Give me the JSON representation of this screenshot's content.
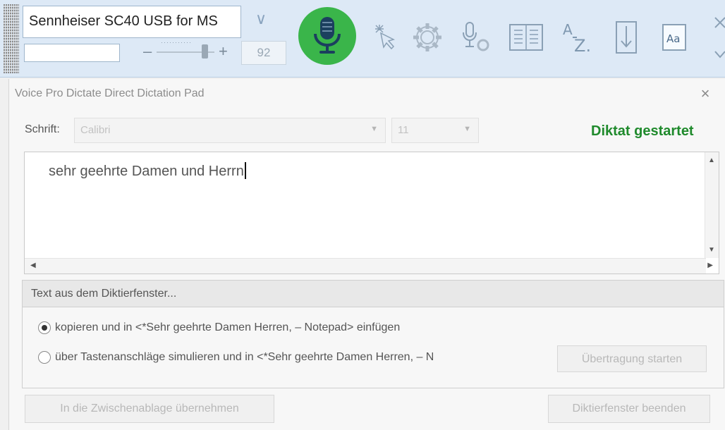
{
  "toolbar": {
    "device_name": "Sennheiser SC40 USB for MS",
    "device_dropdown_glyph": "∨",
    "volume_minus": "–",
    "volume_plus": "+",
    "volume_ticks": "···········",
    "volume_value": "92",
    "volume_level_fraction": 0.92,
    "icons": [
      "microphone-icon",
      "cursor-click-icon",
      "gear-icon",
      "mic-settings-icon",
      "book-icon",
      "a-z-sort-icon",
      "download-icon",
      "font-icon",
      "close-icon",
      "chevron-down-icon"
    ],
    "mic_color": "#3ab54a"
  },
  "dialog": {
    "title": "Voice Pro Dictate Direct Dictation Pad",
    "close_glyph": "×",
    "font_label": "Schrift:",
    "font_value": "Calibri",
    "size_value": "11",
    "status": "Diktat gestartet",
    "status_color": "#1f8a2c",
    "editor_text": "sehr geehrte Damen und Herrn",
    "group_header": "Text aus dem Diktierfenster...",
    "option_copy": "kopieren und in <*Sehr geehrte Damen Herren, – Notepad> einfügen",
    "option_keystroke": "über Tastenanschläge simulieren und in <*Sehr geehrte Damen Herren, – N",
    "start_transfer": "Übertragung starten",
    "clipboard_button": "In die Zwischenablage übernehmen",
    "close_window_button": "Diktierfenster beenden"
  }
}
